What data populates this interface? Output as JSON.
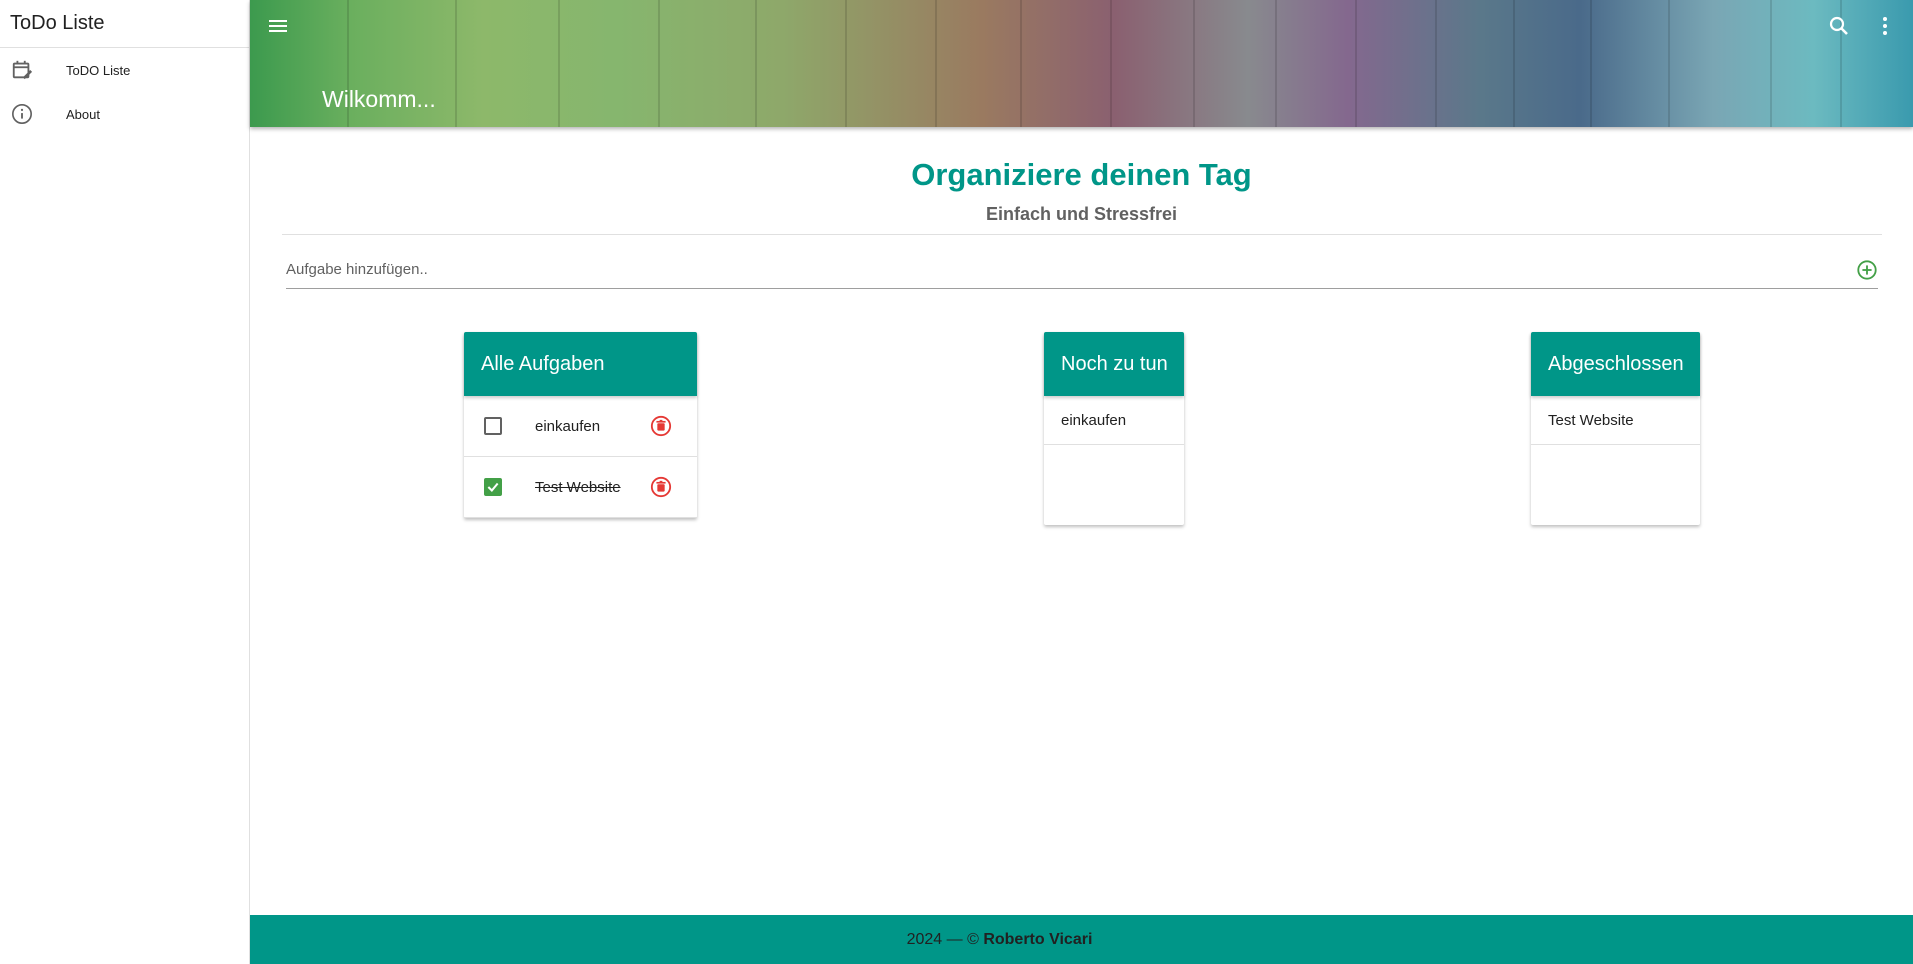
{
  "sidebar": {
    "title": "ToDo Liste",
    "items": [
      {
        "label": "ToDO Liste",
        "icon": "calendar-edit-icon"
      },
      {
        "label": "About",
        "icon": "info-icon"
      }
    ]
  },
  "header": {
    "title": "Wilkomm...",
    "menu_icon": "hamburger-icon",
    "search_icon": "search-icon",
    "more_icon": "more-vert-icon"
  },
  "main": {
    "title": "Organiziere deinen Tag",
    "subtitle": "Einfach und Stressfrei",
    "add_placeholder": "Aufgabe hinzufügen..",
    "add_icon": "add-circle-icon"
  },
  "lists": {
    "all": {
      "title": "Alle Aufgaben",
      "tasks": [
        {
          "text": "einkaufen",
          "done": false
        },
        {
          "text": "Test Website",
          "done": true
        }
      ]
    },
    "todo": {
      "title": "Noch zu tun",
      "items": [
        "einkaufen"
      ]
    },
    "done": {
      "title": "Abgeschlossen",
      "items": [
        "Test Website"
      ]
    }
  },
  "footer": {
    "year": "2024 — ©",
    "author": "Roberto Vicari"
  },
  "colors": {
    "accent": "#009688",
    "check": "#43a047",
    "delete": "#e53935",
    "add": "#43a047"
  }
}
